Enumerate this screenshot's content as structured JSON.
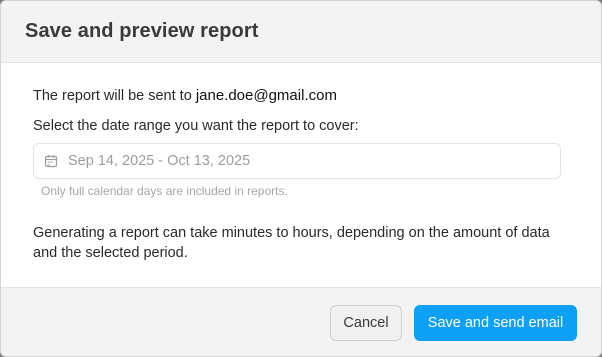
{
  "dialog": {
    "title": "Save and preview report",
    "recipient_prefix": "The report will be sent to ",
    "recipient_email": "jane.doe@gmail.com",
    "date_prompt": "Select the date range you want the report to cover:",
    "date_range": {
      "value": "Sep 14, 2025 - Oct 13, 2025",
      "icon": "calendar-icon",
      "hint": "Only full calendar days are included in reports."
    },
    "generating_note": "Generating a report can take minutes to hours, depending on the amount of data and the selected period."
  },
  "footer": {
    "cancel_label": "Cancel",
    "primary_label": "Save and send email"
  },
  "colors": {
    "primary": "#0ea0f5",
    "header_bg": "#f3f3f3",
    "footer_bg": "#f3f3f3"
  }
}
